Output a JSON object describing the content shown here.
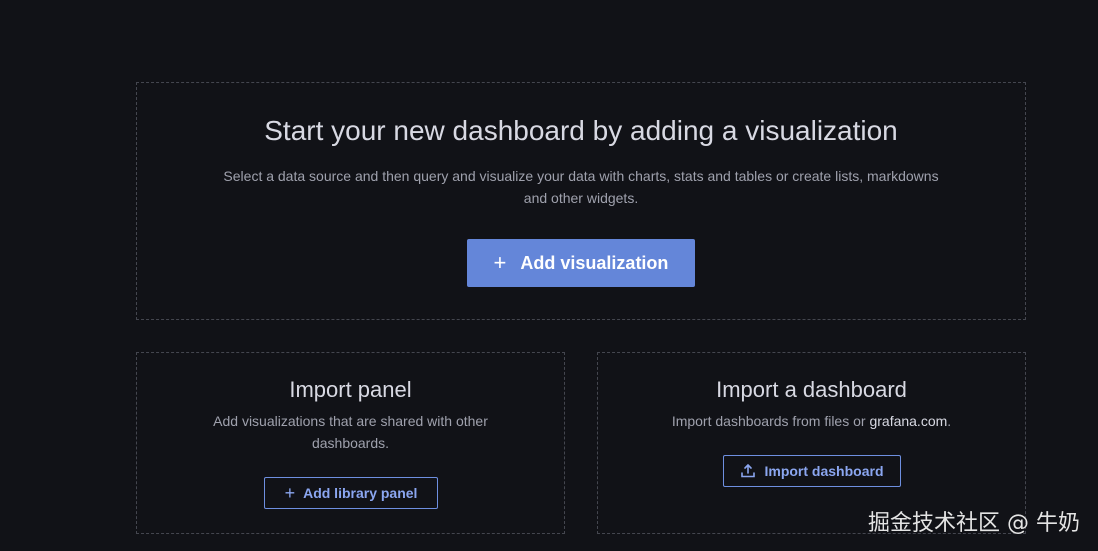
{
  "main": {
    "title": "Start your new dashboard by adding a visualization",
    "description": "Select a data source and then query and visualize your data with charts, stats and tables or create lists, markdowns and other widgets.",
    "add_visualization_label": "Add visualization"
  },
  "import_panel": {
    "title": "Import panel",
    "description": "Add visualizations that are shared with other dashboards.",
    "button_label": "Add library panel"
  },
  "import_dashboard": {
    "title": "Import a dashboard",
    "description_prefix": "Import dashboards from files or ",
    "description_link": "grafana.com",
    "description_suffix": ".",
    "button_label": "Import dashboard"
  },
  "watermark": "掘金技术社区 @ 牛奶",
  "colors": {
    "background": "#111217",
    "primary": "#6486d9",
    "outline": "#6e8fe0"
  }
}
